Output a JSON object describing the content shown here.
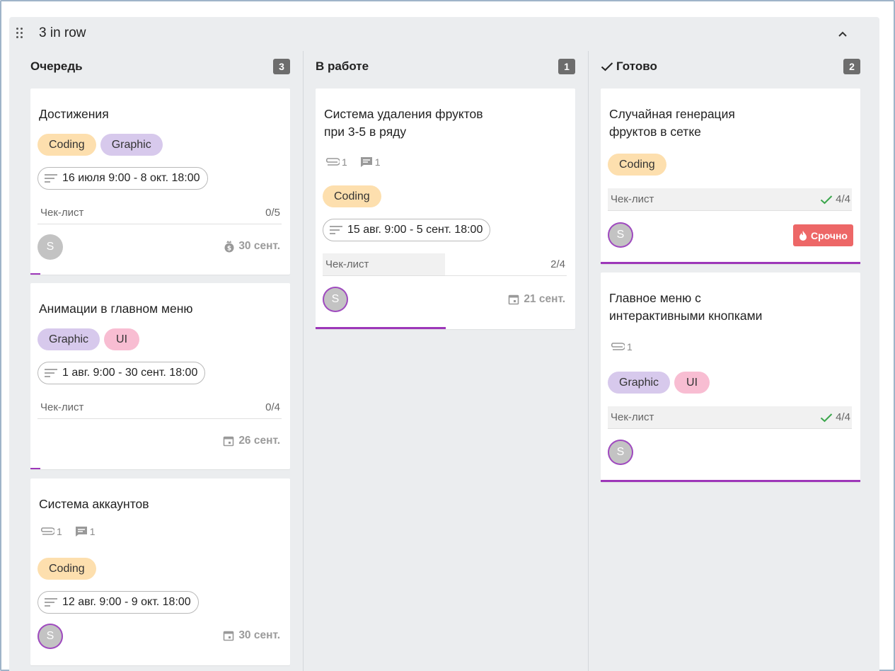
{
  "board": {
    "title": "3 in row"
  },
  "colors": {
    "accent": "#9d37b9",
    "urgent": "#ed6767",
    "coding": "#fddfae",
    "graphic": "#d7c9ec",
    "ui": "#f8bdd2",
    "badge": "#6d6d6d"
  },
  "icons": {
    "drag": "drag-handle-icon",
    "collapse": "chevron-up-icon",
    "check": "check-icon",
    "attachment": "paperclip-icon",
    "comment": "comment-icon",
    "date_range": "notes-lines-icon",
    "calendar": "calendar-icon",
    "money": "money-bag-icon",
    "fire": "fire-icon"
  },
  "columns": [
    {
      "title": "Очередь",
      "count": "3",
      "cards": [
        {
          "title": "Достижения",
          "tags": [
            "Coding",
            "Graphic"
          ],
          "date_range": "16 июля 9:00 - 8 окт. 18:00",
          "checklist_label": "Чек-лист",
          "checklist_count": "0/5",
          "checklist_progress": 0,
          "avatar": "S",
          "due": "30 сент.",
          "progress": 0.04
        },
        {
          "title": "Анимации в главном меню",
          "tags": [
            "Graphic",
            "UI"
          ],
          "date_range": "1 авг. 9:00 - 30 сент. 18:00",
          "checklist_label": "Чек-лист",
          "checklist_count": "0/4",
          "checklist_progress": 0,
          "due": "26 сент.",
          "progress": 0.04
        },
        {
          "title": "Система аккаунтов",
          "attachments": "1",
          "comments": "1",
          "tags": [
            "Coding"
          ],
          "date_range": "12 авг. 9:00 - 9 окт. 18:00",
          "avatar": "S",
          "due": "30 сент."
        }
      ]
    },
    {
      "title": "В работе",
      "count": "1",
      "cards": [
        {
          "title_line1": "Система удаления фруктов",
          "title_line2": "при 3-5 в ряду",
          "attachments": "1",
          "comments": "1",
          "tags": [
            "Coding"
          ],
          "date_range": "15 авг. 9:00 - 5 сент. 18:00",
          "checklist_label": "Чек-лист",
          "checklist_count": "2/4",
          "checklist_progress": 0.5,
          "avatar": "S",
          "due": "21 сент.",
          "progress": 0.5
        }
      ]
    },
    {
      "title": "Готово",
      "count": "2",
      "cards": [
        {
          "title_line1": "Случайная генерация",
          "title_line2": "фруктов в сетке",
          "tags": [
            "Coding"
          ],
          "checklist_label": "Чек-лист",
          "checklist_count": "4/4",
          "checklist_progress": 1,
          "avatar": "S",
          "badge": "Срочно",
          "progress": 1
        },
        {
          "title_line1": "Главное меню с",
          "title_line2": "интерактивными кнопками",
          "attachments": "1",
          "tags": [
            "Graphic",
            "UI"
          ],
          "checklist_label": "Чек-лист",
          "checklist_count": "4/4",
          "checklist_progress": 1,
          "avatar": "S",
          "progress": 1
        }
      ]
    }
  ]
}
